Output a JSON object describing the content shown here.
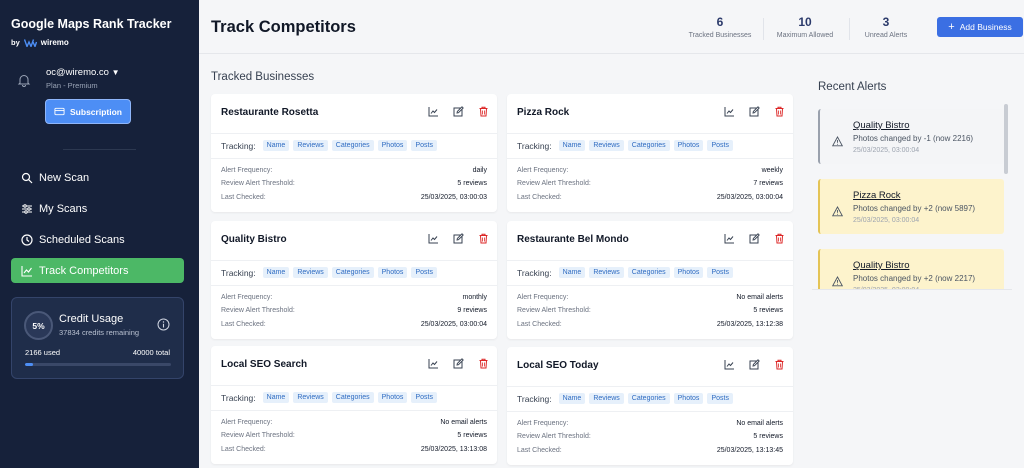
{
  "brand": {
    "title": "Google Maps Rank Tracker",
    "by": "by",
    "logo_text": "wiremo"
  },
  "account": {
    "email": "oc@wiremo.co",
    "dropdown_glyph": "▼",
    "plan": "Plan - Premium",
    "subscription_label": "Subscription"
  },
  "nav": [
    {
      "label": "New Scan",
      "icon": "search-icon"
    },
    {
      "label": "My Scans",
      "icon": "sliders-icon"
    },
    {
      "label": "Scheduled Scans",
      "icon": "clock-icon"
    },
    {
      "label": "Track Competitors",
      "icon": "chart-line-icon",
      "active": true
    }
  ],
  "credit": {
    "percent_label": "5%",
    "title": "Credit Usage",
    "remaining": "37834 credits remaining",
    "used": "2166 used",
    "total": "40000 total",
    "used_fraction": 0.054
  },
  "header": {
    "title": "Track Competitors",
    "stats": [
      {
        "num": "6",
        "label": "Tracked Businesses"
      },
      {
        "num": "10",
        "label": "Maximum Allowed"
      },
      {
        "num": "3",
        "label": "Unread Alerts"
      }
    ],
    "add_label": "Add Business",
    "add_glyph": "+"
  },
  "tracked": {
    "title": "Tracked Businesses",
    "tracking_label": "Tracking:",
    "alert_frequency_label": "Alert Frequency:",
    "threshold_label": "Review Alert Threshold:",
    "last_checked_label": "Last Checked:",
    "chips": [
      "Name",
      "Reviews",
      "Categories",
      "Photos",
      "Posts"
    ],
    "cards": [
      {
        "name": "Restaurante Rosetta",
        "frequency": "daily",
        "threshold": "5 reviews",
        "last_checked": "25/03/2025, 03:00:03"
      },
      {
        "name": "Pizza Rock",
        "frequency": "weekly",
        "threshold": "7 reviews",
        "last_checked": "25/03/2025, 03:00:04"
      },
      {
        "name": "Quality Bistro",
        "frequency": "monthly",
        "threshold": "9 reviews",
        "last_checked": "25/03/2025, 03:00:04"
      },
      {
        "name": "Restaurante Bel Mondo",
        "frequency": "No email alerts",
        "threshold": "5 reviews",
        "last_checked": "25/03/2025, 13:12:38"
      },
      {
        "name": "Local SEO Search",
        "frequency": "No email alerts",
        "threshold": "5 reviews",
        "last_checked": "25/03/2025, 13:13:08"
      },
      {
        "name": "Local SEO Today",
        "frequency": "No email alerts",
        "threshold": "5 reviews",
        "last_checked": "25/03/2025, 13:13:45"
      }
    ]
  },
  "alerts": {
    "title": "Recent Alerts",
    "items": [
      {
        "name": "Quality Bistro",
        "message": "Photos changed by -1 (now 2216)",
        "time": "25/03/2025, 03:00:04",
        "style": "grey"
      },
      {
        "name": "Pizza Rock",
        "message": "Photos changed by +2 (now 5897)",
        "time": "25/03/2025, 03:00:04",
        "style": "yellow"
      },
      {
        "name": "Quality Bistro",
        "message": "Photos changed by +2 (now 2217)",
        "time": "25/03/2025, 03:00:04",
        "style": "yellow"
      }
    ]
  },
  "colors": {
    "sidebar": "#16213a",
    "accent": "#4d8ef5",
    "active_nav": "#4cb866",
    "alert_yellow": "#fdf3cc"
  }
}
